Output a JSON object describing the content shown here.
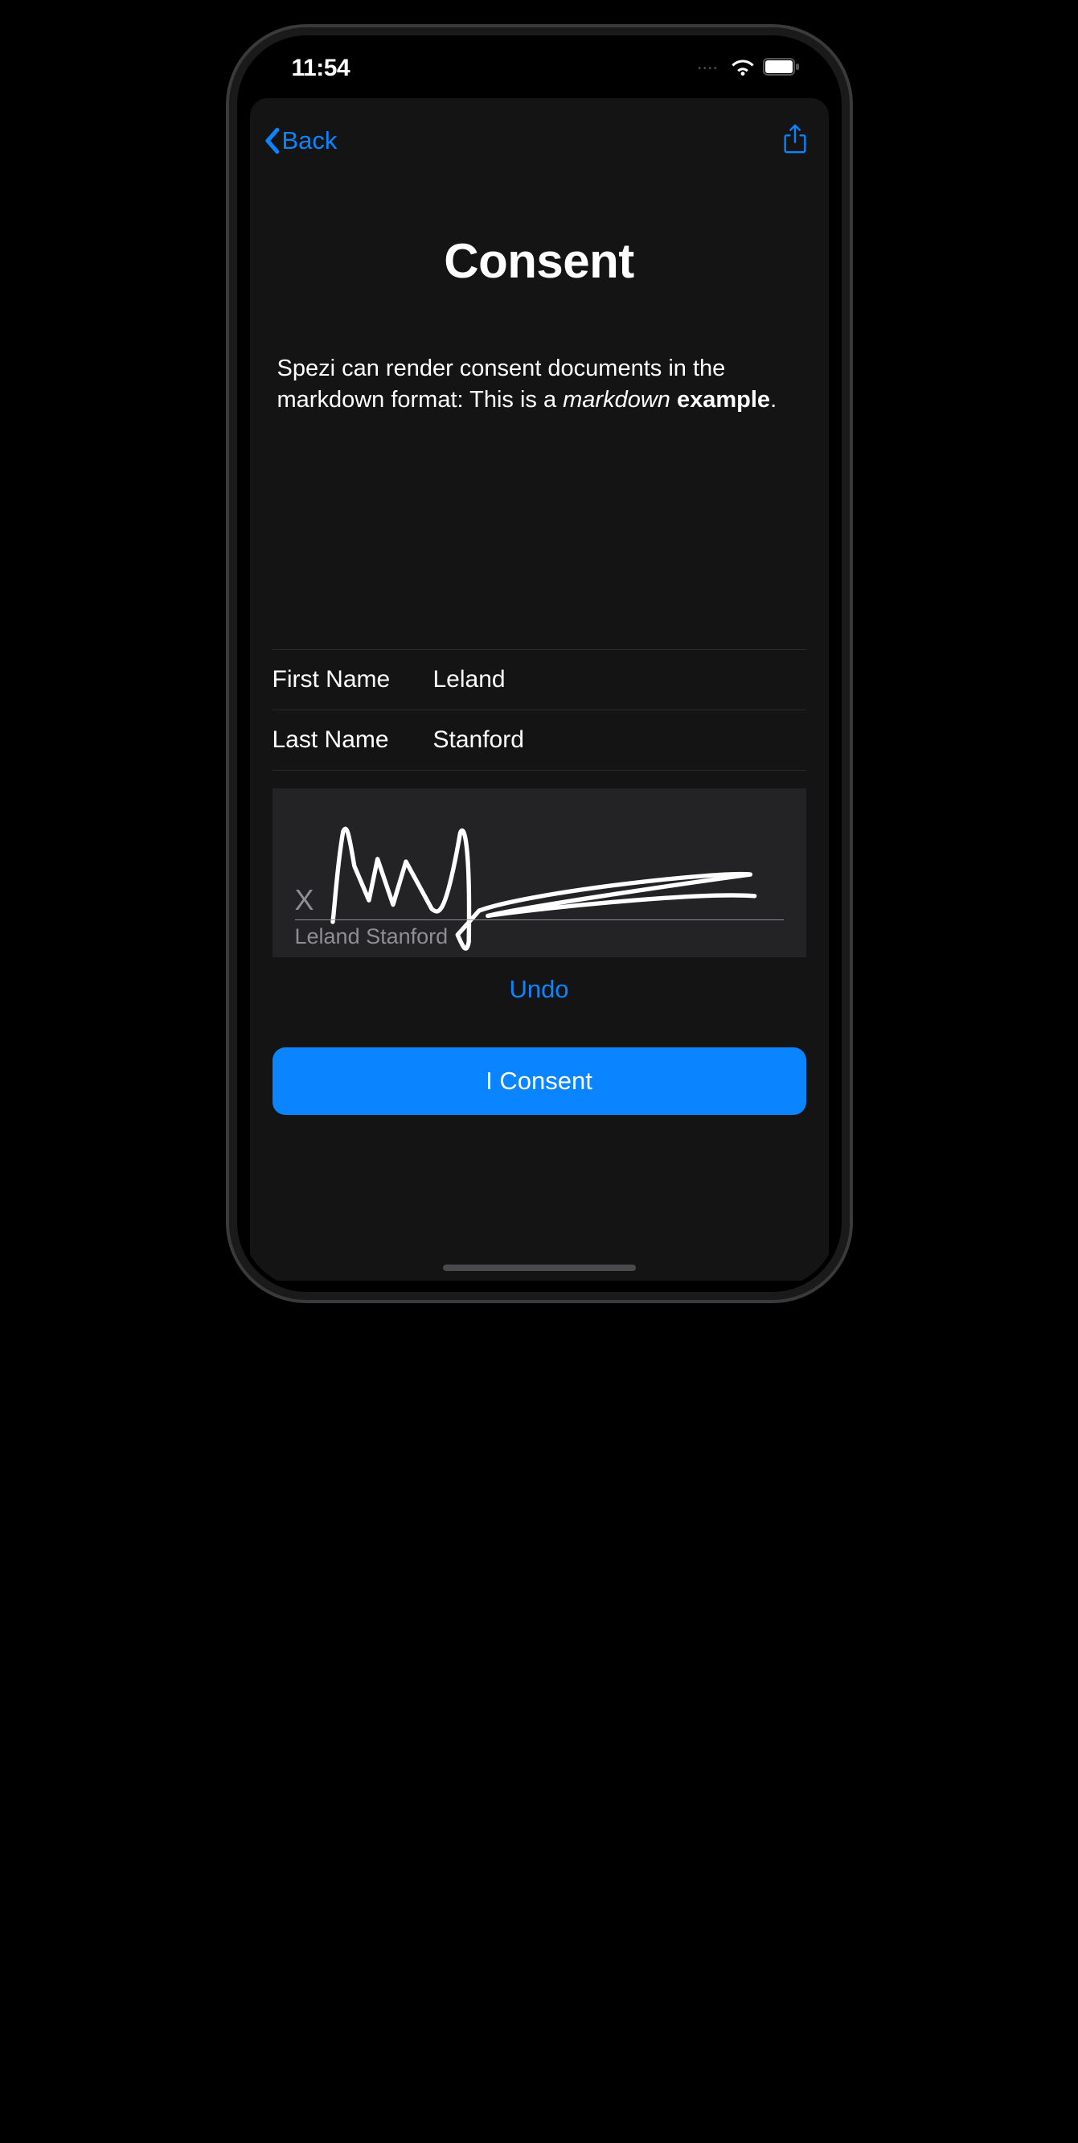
{
  "status": {
    "time": "11:54"
  },
  "nav": {
    "back_label": "Back"
  },
  "page": {
    "title": "Consent",
    "body_prefix": "Spezi can render consent documents in the markdown format: This is a ",
    "body_italic": "markdown",
    "body_space": " ",
    "body_bold": "example",
    "body_suffix": "."
  },
  "form": {
    "first_name_label": "First Name",
    "first_name_value": "Leland",
    "last_name_label": "Last Name",
    "last_name_value": "Stanford"
  },
  "signature": {
    "x_mark": "X",
    "name": "Leland Stanford"
  },
  "actions": {
    "undo": "Undo",
    "consent": "I Consent"
  }
}
